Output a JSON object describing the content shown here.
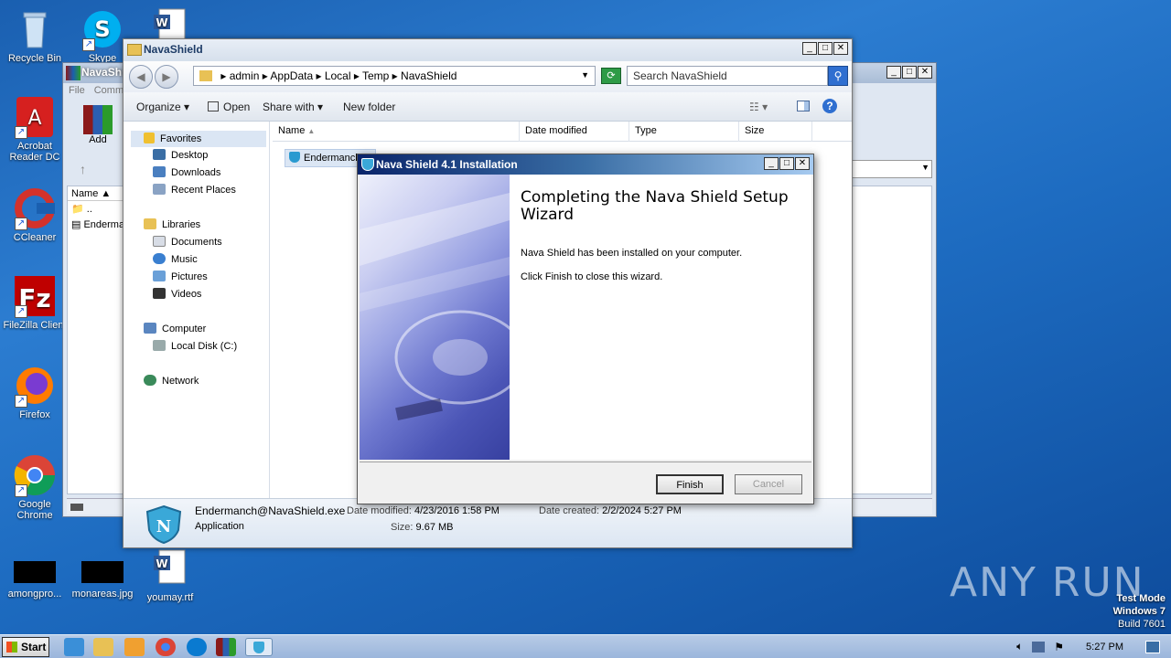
{
  "desktop": {
    "icons": [
      {
        "label": "Recycle Bin"
      },
      {
        "label": "Skype"
      },
      {
        "label": "Acrobat Reader DC"
      },
      {
        "label": "CCleaner"
      },
      {
        "label": "FileZilla Client"
      },
      {
        "label": "Firefox"
      },
      {
        "label": "Google Chrome"
      },
      {
        "label": "amongpro..."
      },
      {
        "label": "monareas.jpg"
      },
      {
        "label": "youmay.rtf"
      }
    ],
    "watermark": "ANY RUN",
    "test_mode": [
      "Test Mode",
      "Windows 7",
      "Build 7601"
    ]
  },
  "rar_window": {
    "title": "NavaShi",
    "menu": [
      "File",
      "Comm"
    ],
    "add_label": "Add",
    "col_name": "Name",
    "rows": [
      "..",
      "Enderma"
    ]
  },
  "explorer": {
    "title": "NavaShield",
    "breadcrumb": [
      "admin",
      "AppData",
      "Local",
      "Temp",
      "NavaShield"
    ],
    "search_placeholder": "Search NavaShield",
    "toolbar": {
      "organize": "Organize",
      "open": "Open",
      "share_with": "Share with",
      "new_folder": "New folder"
    },
    "nav": {
      "favorites": "Favorites",
      "desktop": "Desktop",
      "downloads": "Downloads",
      "recent": "Recent Places",
      "libraries": "Libraries",
      "documents": "Documents",
      "music": "Music",
      "pictures": "Pictures",
      "videos": "Videos",
      "computer": "Computer",
      "local_disk": "Local Disk (C:)",
      "network": "Network"
    },
    "columns": {
      "name": "Name",
      "date_modified": "Date modified",
      "type": "Type",
      "size": "Size"
    },
    "file_item": "Endermancl",
    "details": {
      "filename": "Endermanch@NavaShield.exe",
      "type": "Application",
      "date_modified_label": "Date modified:",
      "date_modified": "4/23/2016 1:58 PM",
      "size_label": "Size:",
      "size": "9.67 MB",
      "date_created_label": "Date created:",
      "date_created": "2/2/2024 5:27 PM"
    }
  },
  "installer": {
    "title": "Nava Shield 4.1 Installation",
    "heading": "Completing the Nava Shield Setup Wizard",
    "line1": "Nava Shield has been installed on your computer.",
    "line2": "Click Finish to close this wizard.",
    "finish": "Finish",
    "cancel": "Cancel"
  },
  "taskbar": {
    "start": "Start",
    "clock": "5:27 PM"
  }
}
